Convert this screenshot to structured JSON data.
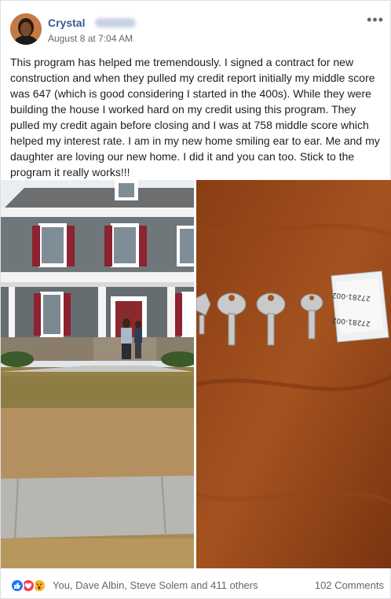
{
  "post": {
    "author": "Crystal",
    "timestamp": "August 8 at 7:04 AM",
    "body": "This program has helped me tremendously. I signed a contract for new construction and when they pulled my credit report initially my middle score was 647 (which is good considering I started in the 400s). While they were building the house I worked hard on my credit using this program. They pulled my credit again before closing and I was at 758 middle score which helped my interest rate. I am in my new home smiling ear to ear. Me and my daughter are loving our new home. I did it and you can too. Stick to the program it really works!!!"
  },
  "photos": [
    {
      "icon": "house-photo",
      "key_tag_text_1": "27281-002",
      "key_tag_text_2": "27281-002"
    }
  ],
  "footer": {
    "reactions_text": "You, Dave Albin, Steve Solem and 411 others",
    "comments_text": "102 Comments",
    "reaction_icons": [
      "like-icon",
      "love-icon",
      "wow-icon"
    ]
  },
  "colors": {
    "author": "#385898",
    "like": "#1877f2",
    "love": "#f33e58",
    "wow": "#f7b125"
  }
}
